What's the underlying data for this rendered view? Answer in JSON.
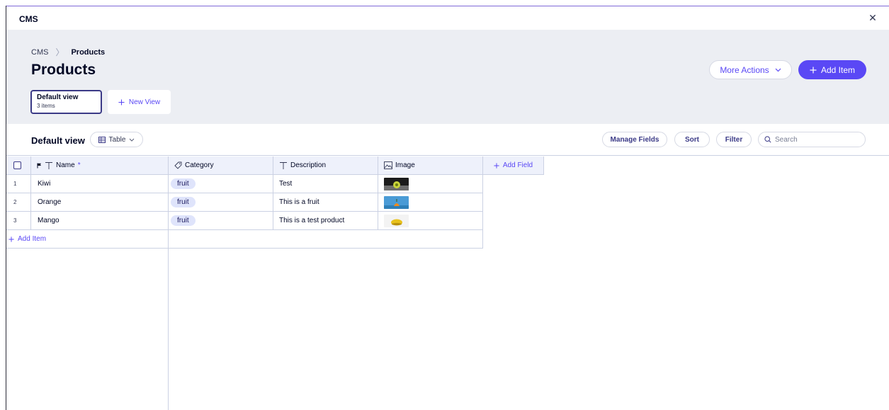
{
  "window": {
    "title": "CMS",
    "close_icon": "close-icon"
  },
  "breadcrumb": {
    "root": "CMS",
    "separator": "〉",
    "current": "Products"
  },
  "page": {
    "title": "Products"
  },
  "actions": {
    "more_actions": "More Actions",
    "add_item": "Add Item"
  },
  "views": {
    "active": {
      "title": "Default view",
      "count": "3 items"
    },
    "new_view": "New View"
  },
  "toolbar": {
    "view_title": "Default view",
    "layout": "Table",
    "manage_fields": "Manage Fields",
    "sort": "Sort",
    "filter": "Filter",
    "search_placeholder": "Search"
  },
  "table": {
    "columns": {
      "name": "Name",
      "required_mark": "*",
      "category": "Category",
      "description": "Description",
      "image": "Image",
      "add_field": "Add Field"
    },
    "rows": [
      {
        "num": "1",
        "name": "Kiwi",
        "category": "fruit",
        "description": "Test"
      },
      {
        "num": "2",
        "name": "Orange",
        "category": "fruit",
        "description": "This is a fruit"
      },
      {
        "num": "3",
        "name": "Mango",
        "category": "fruit",
        "description": "This is a test product"
      }
    ],
    "add_item": "Add Item"
  },
  "colors": {
    "accent": "#5a48f5",
    "header_bg": "#eceef3",
    "table_header_bg": "#eef1fb",
    "tag_bg": "#dfe4fb"
  }
}
